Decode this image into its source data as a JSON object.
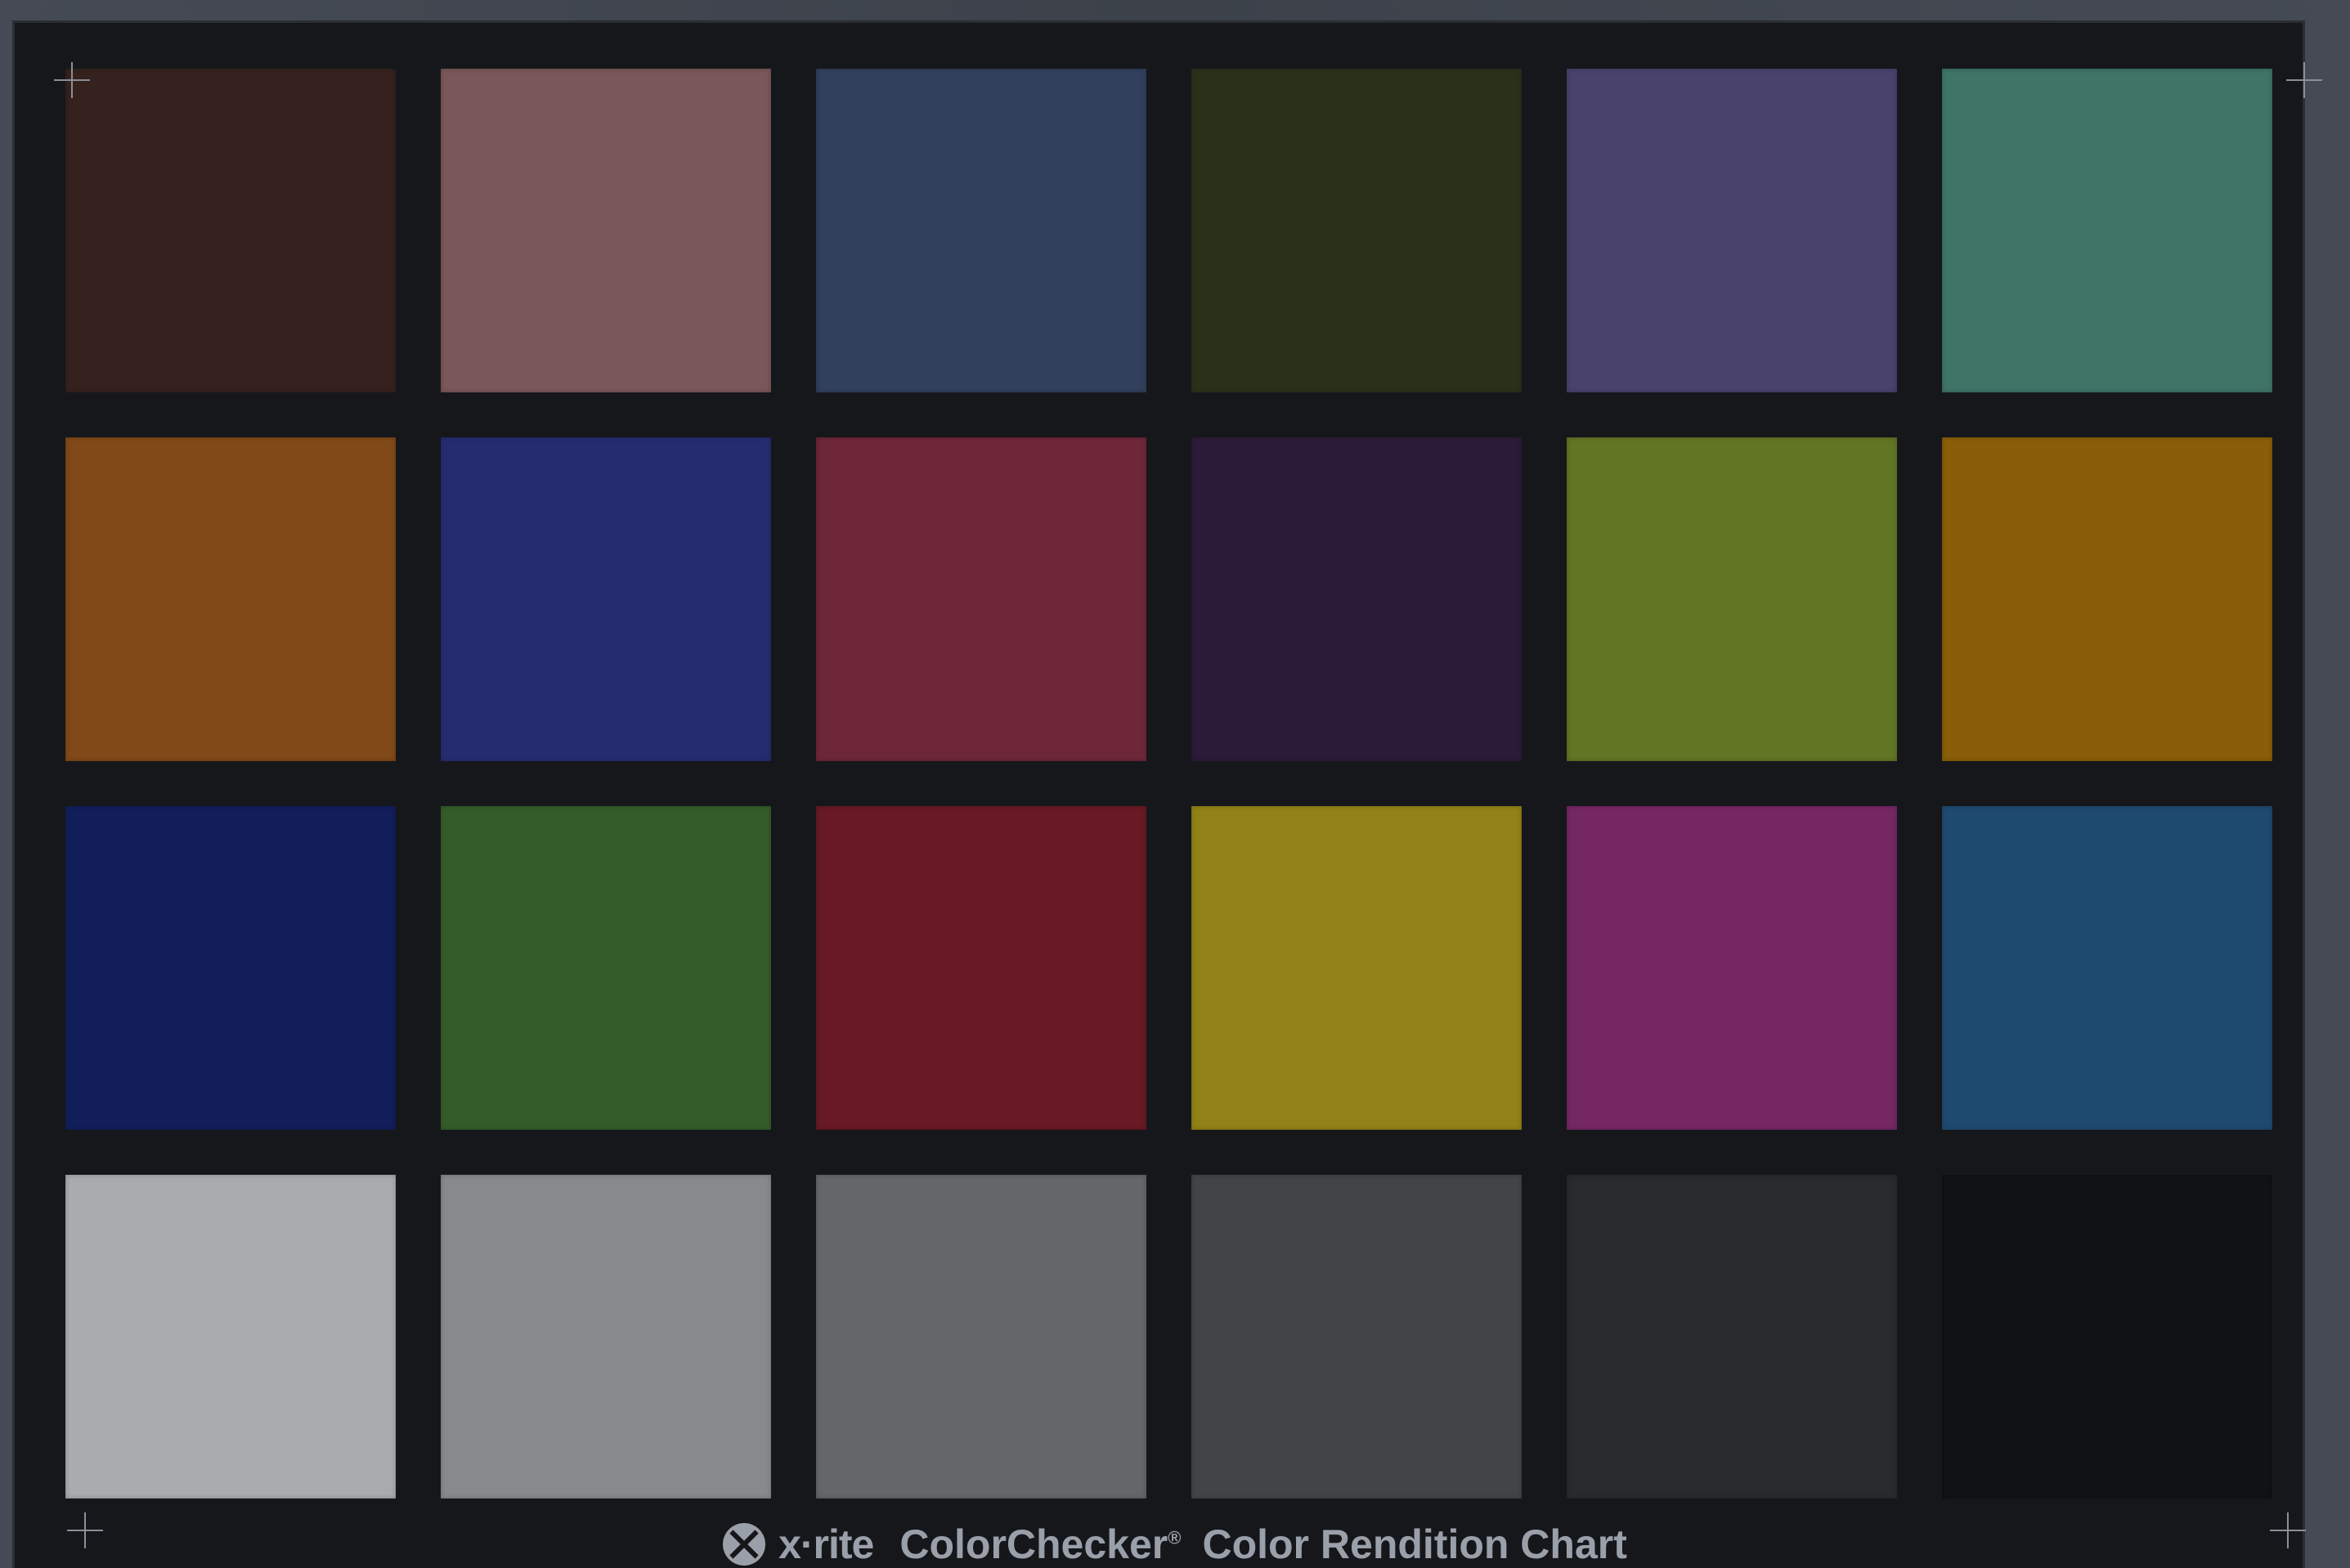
{
  "footer": {
    "brand": "x·rite",
    "product": "ColorChecker",
    "registered_mark": "®",
    "subtitle": "Color Rendition Chart"
  },
  "patches": [
    {
      "color": "#35211d"
    },
    {
      "color": "#7a5758"
    },
    {
      "color": "#31405c"
    },
    {
      "color": "#2a311a"
    },
    {
      "color": "#48426c"
    },
    {
      "color": "#3f7467"
    },
    {
      "color": "#814918"
    },
    {
      "color": "#262c70"
    },
    {
      "color": "#6e2739"
    },
    {
      "color": "#2c1b38"
    },
    {
      "color": "#627524"
    },
    {
      "color": "#8a5e08"
    },
    {
      "color": "#121e5a"
    },
    {
      "color": "#345c2a"
    },
    {
      "color": "#681924"
    },
    {
      "color": "#918217"
    },
    {
      "color": "#752764"
    },
    {
      "color": "#1f4a6f"
    },
    {
      "color": "#a9abae"
    },
    {
      "color": "#868a8d"
    },
    {
      "color": "#64676a"
    },
    {
      "color": "#424447"
    },
    {
      "color": "#292a2c"
    },
    {
      "color": "#111215"
    }
  ]
}
